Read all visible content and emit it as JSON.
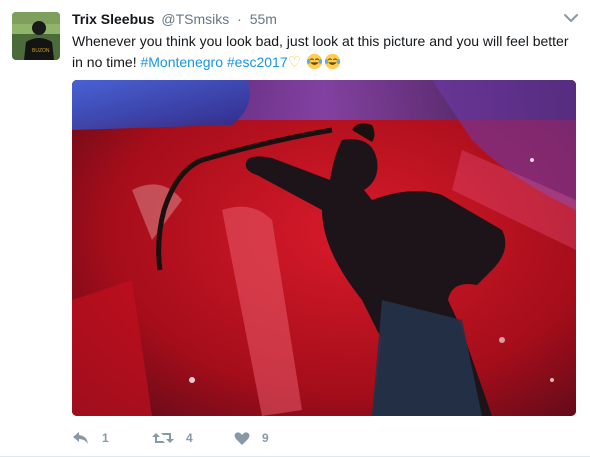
{
  "tweet": {
    "name": "Trix Sleebus",
    "handle": "@TSmsiks",
    "separator": "·",
    "time": "55m",
    "text_line1": "Whenever you think you look bad, just look at this picture and you will feel better",
    "text_line2_prefix": "in no time! ",
    "hashtag1": "#Montenegro",
    "hashtag2": "#esc2017",
    "heart_emoji": "♡",
    "avatar_text": "BUZON",
    "actions": {
      "reply_count": "1",
      "retweet_count": "4",
      "like_count": "9"
    }
  },
  "colors": {
    "link": "#1b95e0",
    "muted": "#657786",
    "action_icon": "#8899a6"
  },
  "icons": [
    "chevron-down-icon",
    "reply-icon",
    "retweet-icon",
    "like-icon",
    "crying-laughing-emoji"
  ]
}
